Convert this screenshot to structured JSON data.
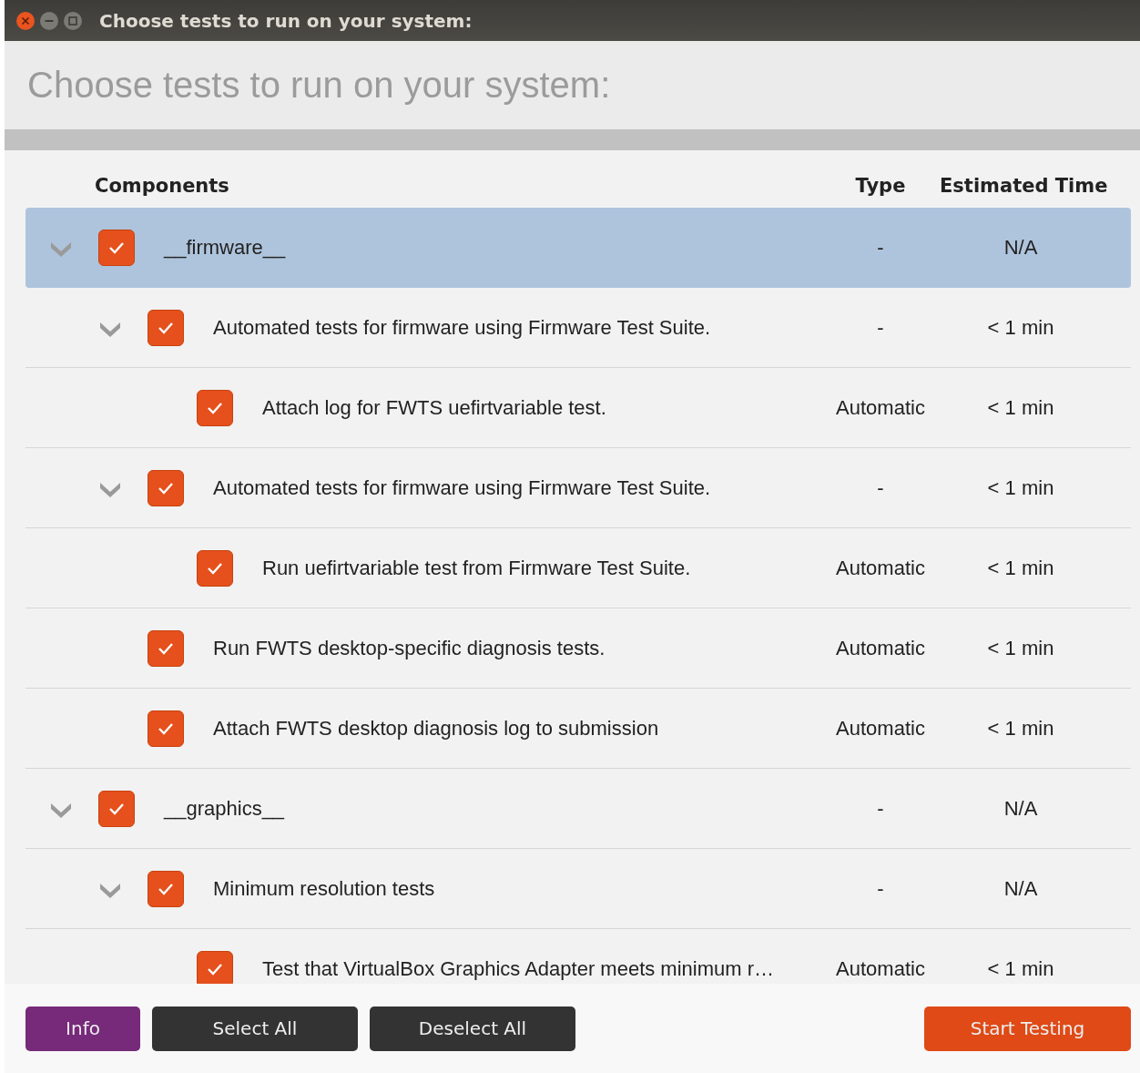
{
  "window": {
    "title": "Choose tests to run on your system:"
  },
  "heading": "Choose tests to run on your system:",
  "columns": [
    "Components",
    "Type",
    "Estimated Time"
  ],
  "components": [
    {
      "label": "__firmware__",
      "type": "-",
      "time": "N/A",
      "checked": true,
      "selected": true,
      "expanded": true,
      "children": [
        {
          "label": "Automated tests for firmware using Firmware Test Suite.",
          "type": "-",
          "time": "< 1 min",
          "checked": true,
          "selected": false,
          "expanded": true,
          "children": [
            {
              "label": "Attach log for FWTS uefirtvariable test.",
              "type": "Automatic",
              "time": "< 1 min",
              "checked": true,
              "selected": false
            }
          ]
        },
        {
          "label": "Automated tests for firmware using Firmware Test Suite.",
          "type": "-",
          "time": "< 1 min",
          "checked": true,
          "selected": false,
          "expanded": true,
          "children": [
            {
              "label": "Run uefirtvariable test from Firmware Test Suite.",
              "type": "Automatic",
              "time": "< 1 min",
              "checked": true,
              "selected": false
            }
          ]
        },
        {
          "label": "Run FWTS desktop-specific diagnosis tests.",
          "type": "Automatic",
          "time": "< 1 min",
          "checked": true,
          "selected": false
        },
        {
          "label": "Attach FWTS desktop diagnosis log to submission",
          "type": "Automatic",
          "time": "< 1 min",
          "checked": true,
          "selected": false
        }
      ]
    },
    {
      "label": "__graphics__",
      "type": "-",
      "time": "N/A",
      "checked": true,
      "selected": false,
      "expanded": true,
      "children": [
        {
          "label": "Minimum resolution tests",
          "type": "-",
          "time": "N/A",
          "checked": true,
          "selected": false,
          "expanded": true,
          "children": [
            {
              "label": "Test that VirtualBox Graphics Adapter meets minimum r…",
              "type": "Automatic",
              "time": "< 1 min",
              "checked": true,
              "selected": false
            }
          ]
        }
      ]
    }
  ],
  "buttons": [
    {
      "label": "Info",
      "kind": "info"
    },
    {
      "label": "Select All",
      "kind": "dark"
    },
    {
      "label": "Deselect All",
      "kind": "dark"
    },
    {
      "label": "Start Testing",
      "kind": "primary"
    }
  ]
}
